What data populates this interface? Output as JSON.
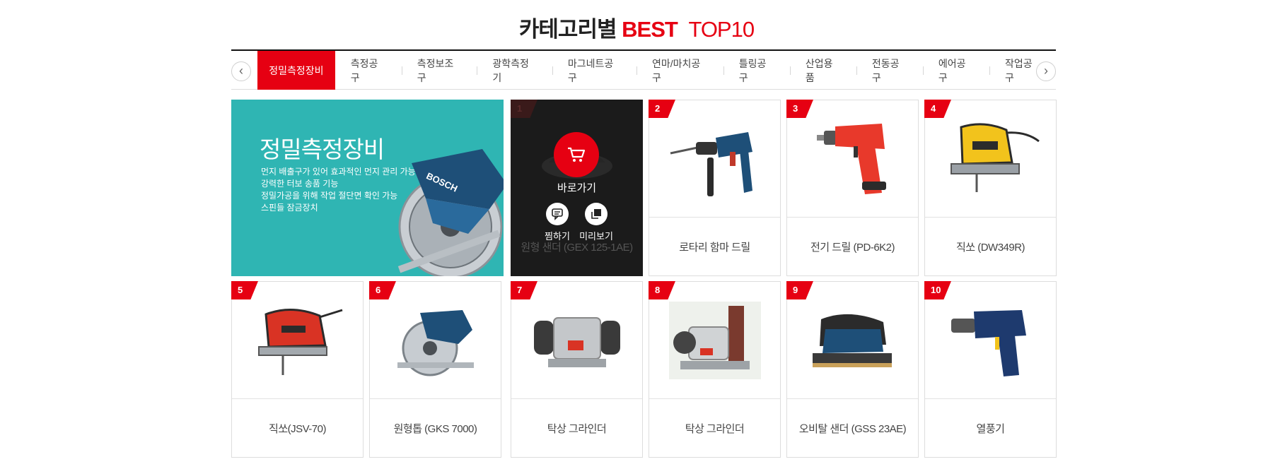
{
  "header": {
    "title_prefix": "카테고리별",
    "title_best": "BEST",
    "title_top": "TOP10"
  },
  "nav": {
    "prev_label": "‹",
    "next_label": "›",
    "tabs": [
      "정밀측정장비",
      "측정공구",
      "측정보조구",
      "광학측정기",
      "마그네트공구",
      "연마/마치공구",
      "틀링공구",
      "산업용품",
      "전동공구",
      "에어공구",
      "작업공구"
    ],
    "active_index": 0
  },
  "banner": {
    "title": "정밀측정장비",
    "lines": [
      "먼지 배출구가 있어 효과적인 먼지 관리 가능",
      "강력한 터보 송품 기능",
      "정밀가공을 위해 작업 절단면 확인 가능",
      "스핀들 잠금장치"
    ],
    "image_icon": "circular-saw-icon",
    "image_logo_text": "BOSCH",
    "bg_color": "#2fb5b3"
  },
  "hover_card": {
    "goto_label": "바로가기",
    "wish_label": "찜하기",
    "preview_label": "미리보기"
  },
  "products": [
    {
      "rank": "1",
      "name": "원형 샌더 (GEX 125-1AE)",
      "icon": "random-orbit-sander-icon"
    },
    {
      "rank": "2",
      "name": "로타리 함마 드릴",
      "icon": "rotary-hammer-drill-icon"
    },
    {
      "rank": "3",
      "name": "전기 드릴 (PD-6K2)",
      "icon": "electric-drill-icon"
    },
    {
      "rank": "4",
      "name": "직쏘 (DW349R)",
      "icon": "jigsaw-icon"
    },
    {
      "rank": "5",
      "name": "직쏘(JSV-70)",
      "icon": "jigsaw-icon"
    },
    {
      "rank": "6",
      "name": "원형톱 (GKS 7000)",
      "icon": "circular-saw-icon"
    },
    {
      "rank": "7",
      "name": "탁상 그라인더",
      "icon": "bench-grinder-icon"
    },
    {
      "rank": "8",
      "name": "탁상 그라인더",
      "icon": "belt-grinder-icon"
    },
    {
      "rank": "9",
      "name": "오비탈 샌더 (GSS 23AE)",
      "icon": "orbital-sander-icon"
    },
    {
      "rank": "10",
      "name": "열풍기",
      "icon": "heat-gun-icon"
    }
  ],
  "colors": {
    "accent": "#e60012",
    "teal": "#2fb5b3",
    "dark_card": "#1b1b1b"
  }
}
